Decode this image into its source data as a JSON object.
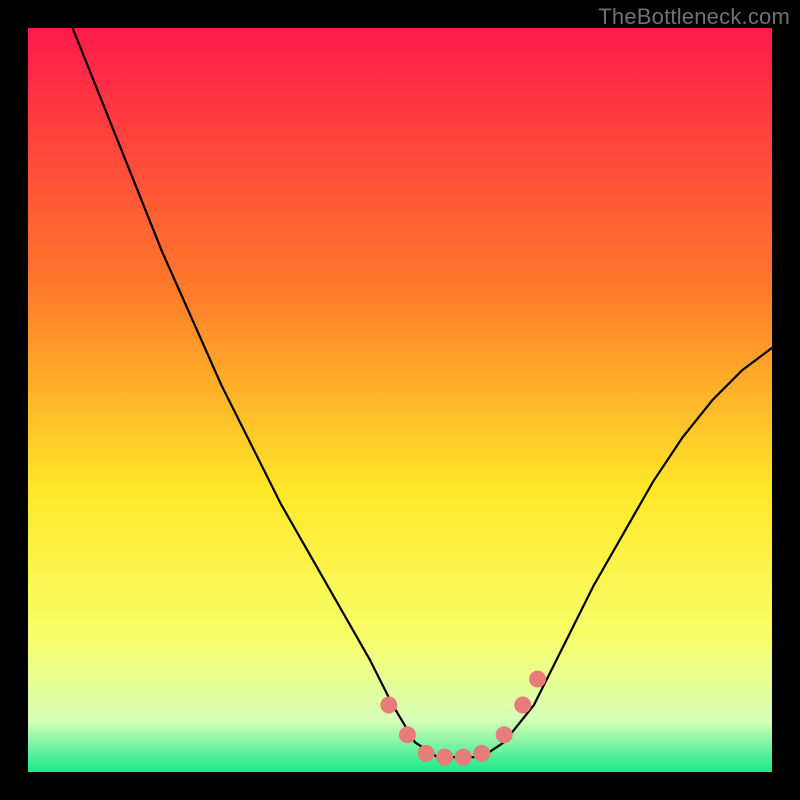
{
  "watermark": "TheBottleneck.com",
  "colors": {
    "gradient_top": "#ff1a4b",
    "gradient_mid1": "#ff7a2a",
    "gradient_mid2": "#ffe728",
    "gradient_mid3": "#f8ff6a",
    "gradient_bottom_pale": "#d8ffb8",
    "gradient_bottom": "#18e98b",
    "curve": "#000000",
    "marker": "#e77c7a",
    "frame_bg": "#000000"
  },
  "chart_data": {
    "type": "line",
    "title": "",
    "xlabel": "",
    "ylabel": "",
    "xlim": [
      0,
      100
    ],
    "ylim": [
      0,
      100
    ],
    "grid": false,
    "legend": false,
    "series": [
      {
        "name": "bottleneck-curve",
        "x": [
          6,
          10,
          14,
          18,
          22,
          26,
          30,
          34,
          38,
          42,
          46,
          49,
          52,
          55,
          58,
          61,
          64,
          68,
          72,
          76,
          80,
          84,
          88,
          92,
          96,
          100
        ],
        "y": [
          100,
          90,
          80,
          70,
          61,
          52,
          44,
          36,
          29,
          22,
          15,
          9,
          4,
          2,
          2,
          2,
          4,
          9,
          17,
          25,
          32,
          39,
          45,
          50,
          54,
          57
        ]
      }
    ],
    "markers": [
      {
        "x": 48.5,
        "y": 9.0
      },
      {
        "x": 51.0,
        "y": 5.0
      },
      {
        "x": 53.5,
        "y": 2.5
      },
      {
        "x": 56.0,
        "y": 2.0
      },
      {
        "x": 58.5,
        "y": 2.0
      },
      {
        "x": 61.0,
        "y": 2.5
      },
      {
        "x": 64.0,
        "y": 5.0
      },
      {
        "x": 66.5,
        "y": 9.0
      },
      {
        "x": 68.5,
        "y": 12.5
      }
    ],
    "annotations": []
  }
}
